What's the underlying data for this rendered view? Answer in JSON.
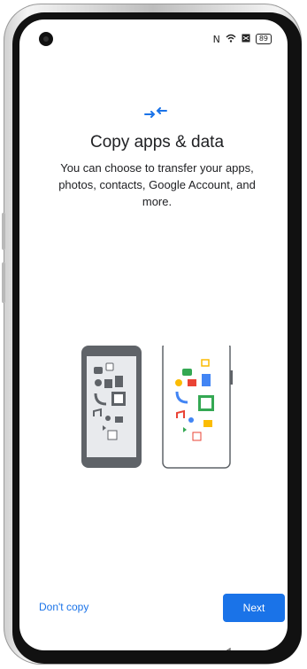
{
  "status_bar": {
    "battery": "89"
  },
  "main": {
    "title": "Copy apps & data",
    "subtitle": "You can choose to transfer your apps, photos, contacts, Google Account, and more."
  },
  "actions": {
    "dont_copy_label": "Don't copy",
    "next_label": "Next"
  },
  "colors": {
    "accent": "#1a73e8",
    "title_text": "#202124"
  },
  "icons": [
    "transfer-arrows-icon",
    "back-nav-icon",
    "nfc-icon",
    "wifi-icon",
    "battery-icon"
  ]
}
